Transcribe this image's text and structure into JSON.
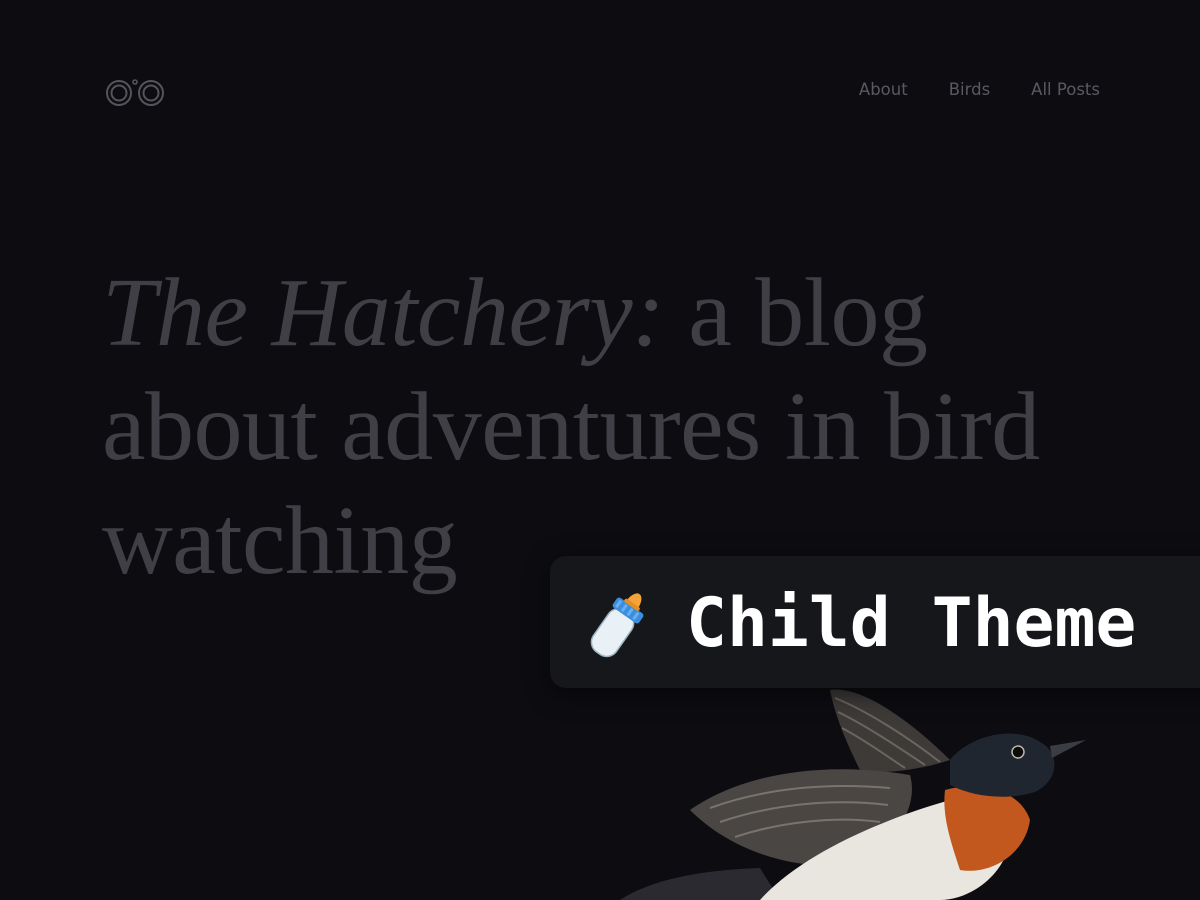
{
  "header": {
    "logo_icon": "binoculars-icon",
    "nav": [
      {
        "label": "About"
      },
      {
        "label": "Birds"
      },
      {
        "label": "All Posts"
      }
    ]
  },
  "hero": {
    "title_italic": "The Hatchery:",
    "title_rest": " a blog about adventures in bird watching"
  },
  "badge": {
    "icon": "baby-bottle-icon",
    "label": "Child Theme"
  },
  "illustration": {
    "icon": "bird-illustration"
  },
  "colors": {
    "background": "#0d0c11",
    "nav_text": "#5a5960",
    "hero_text": "#403f45",
    "badge_bg": "#15171b",
    "badge_text": "#ffffff"
  }
}
